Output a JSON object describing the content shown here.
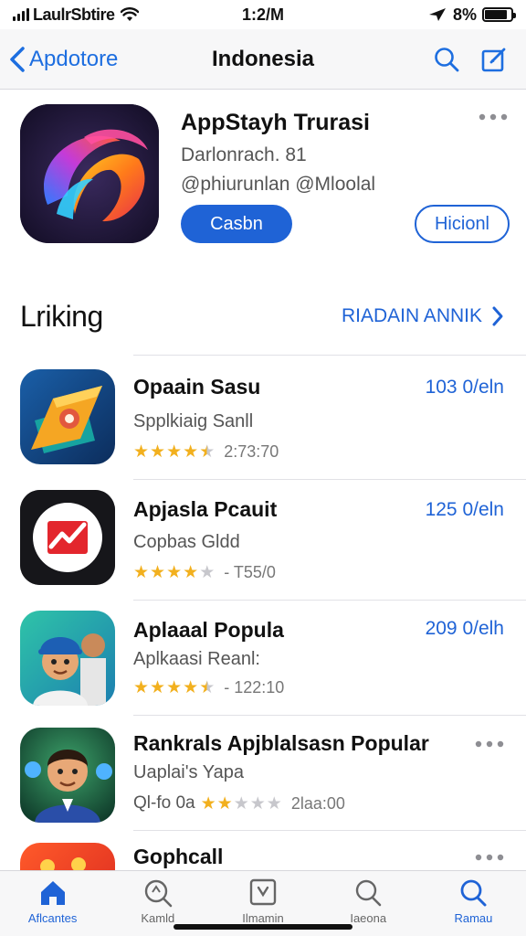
{
  "status_bar": {
    "carrier": "LaulrSbtire",
    "time": "1:2/M",
    "battery": "8%",
    "battery_level": 0.85
  },
  "nav": {
    "back_label": "Apdotore",
    "title": "Indonesia",
    "icons": [
      "search-icon",
      "compose-icon"
    ]
  },
  "featured": {
    "title": "AppStayh Trurasi",
    "subtitle": "Darlonrach. 81",
    "developer": "@phiurunlan @Mloolal",
    "primary_button": "Casbn",
    "secondary_button": "Hicionl",
    "icon": "swirl-app-icon"
  },
  "section": {
    "title": "Lriking",
    "link_label": "RIADAIN ANNIK"
  },
  "apps": [
    {
      "name": "Opaain Sasu",
      "sub": "Spplkiaig Sanll",
      "stars": 4.5,
      "count": "2:73:70",
      "price": "103 0/eln",
      "icon": "orange-folder-app-icon"
    },
    {
      "name": "Apjasla Pcauit",
      "sub": "Copbas Gldd",
      "stars": 4,
      "count": "- T55/0",
      "price": "125 0/eln",
      "icon": "red-chart-app-icon"
    },
    {
      "name": "Aplaaal  Popula",
      "sub": "Aplkaasi Reanl:",
      "stars": 4.5,
      "count": "- 122:10",
      "price": "209 0/elh",
      "icon": "cartoon-people-app-icon"
    },
    {
      "name": "Rankrals Apjblalsasn Popular",
      "sub": "Uaplai's Yapa",
      "rating_prefix": "Ql-fo 0a",
      "stars": 2,
      "count": "2laa:00",
      "price": "",
      "icon": "cartoon-man-app-icon"
    },
    {
      "name": "Gophcall",
      "sub": "",
      "stars": 0,
      "count": "",
      "price": "",
      "icon": "red-game-app-icon"
    }
  ],
  "tabs": [
    {
      "label": "Aflcantes",
      "icon": "home-icon",
      "active": true
    },
    {
      "label": "Kamld",
      "icon": "search-icon",
      "active": false
    },
    {
      "label": "Ilmamin",
      "icon": "checkbox-icon",
      "active": false
    },
    {
      "label": "Iaeona",
      "icon": "search-icon",
      "active": false
    },
    {
      "label": "Ramau",
      "icon": "search-icon",
      "active": true
    }
  ],
  "colors": {
    "accent": "#1f63d6",
    "star": "#f2b01e",
    "star_empty": "#c7c7cc"
  }
}
